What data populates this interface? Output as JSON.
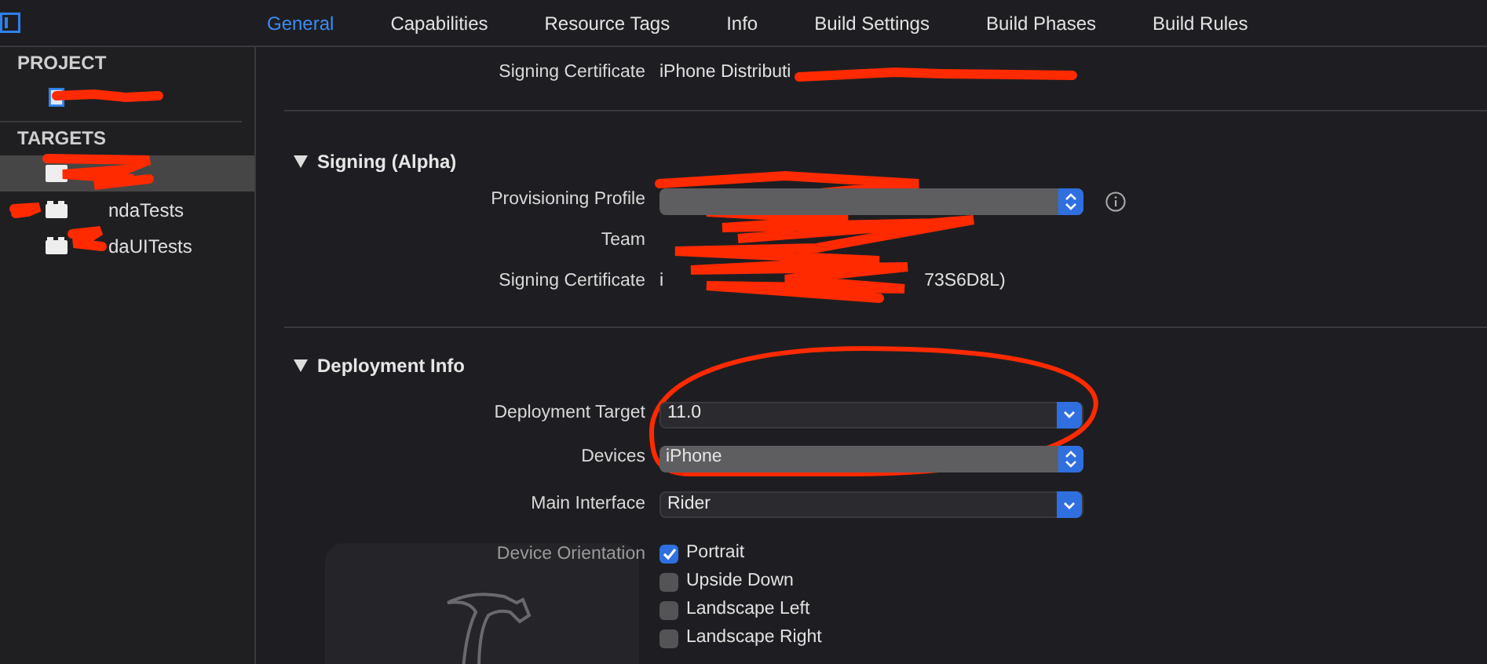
{
  "toolbar": {
    "tabs": [
      {
        "label": "General",
        "selected": true
      },
      {
        "label": "Capabilities",
        "selected": false
      },
      {
        "label": "Resource Tags",
        "selected": false
      },
      {
        "label": "Info",
        "selected": false
      },
      {
        "label": "Build Settings",
        "selected": false
      },
      {
        "label": "Build Phases",
        "selected": false
      },
      {
        "label": "Build Rules",
        "selected": false
      }
    ]
  },
  "sidebar": {
    "sections": [
      {
        "title": "PROJECT",
        "items": [
          {
            "kind": "project",
            "selected": false
          }
        ]
      },
      {
        "title": "TARGETS",
        "items": [
          {
            "kind": "app",
            "selected": true
          },
          {
            "kind": "test",
            "label": "ndaTests",
            "selected": false
          },
          {
            "kind": "test",
            "label": "daUITests",
            "selected": false
          }
        ]
      }
    ]
  },
  "sections": [
    {
      "rows": [
        {
          "kind": "text",
          "label": "Signing Certificate",
          "value": "iPhone Distributi"
        }
      ]
    },
    {
      "title": "Signing (Alpha)",
      "expanded": true,
      "rows": [
        {
          "kind": "popup",
          "label": "Provisioning Profile",
          "info": true
        },
        {
          "kind": "text",
          "label": "Team"
        },
        {
          "kind": "text",
          "label": "Signing Certificate",
          "value": "i",
          "suffix": "73S6D8L)"
        }
      ]
    },
    {
      "title": "Deployment Info",
      "expanded": true,
      "rows": [
        {
          "kind": "combo",
          "label": "Deployment Target",
          "value": "11.0"
        },
        {
          "kind": "popup",
          "label": "Devices",
          "value": "iPhone"
        },
        {
          "kind": "combo",
          "label": "Main Interface",
          "value": "Rider"
        },
        {
          "kind": "checks",
          "label": "Device Orientation",
          "options": [
            {
              "label": "Portrait",
              "checked": true
            },
            {
              "label": "Upside Down",
              "checked": false
            },
            {
              "label": "Landscape Left",
              "checked": false
            },
            {
              "label": "Landscape Right",
              "checked": false
            }
          ]
        }
      ]
    }
  ]
}
